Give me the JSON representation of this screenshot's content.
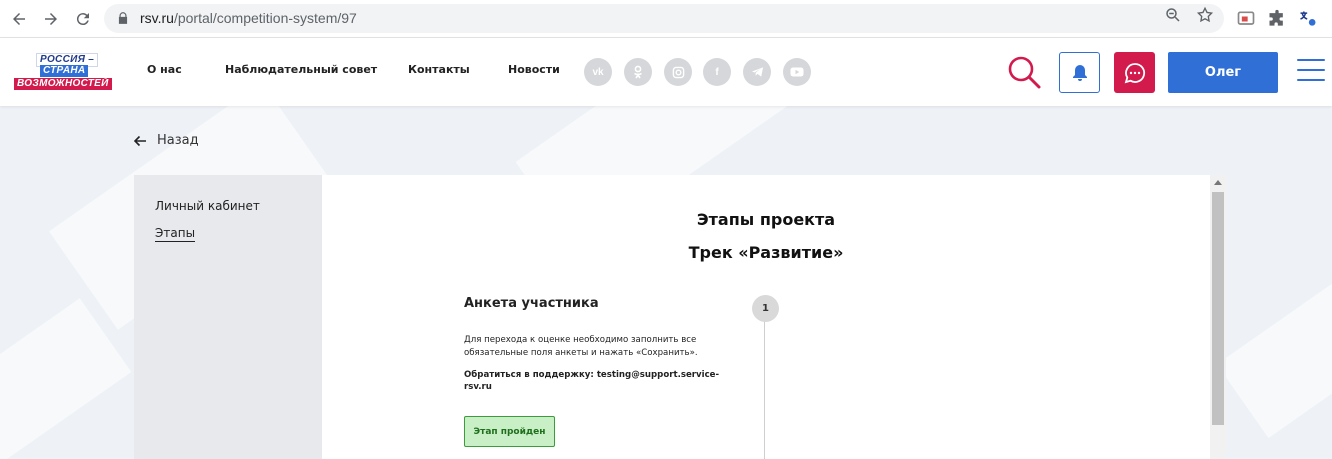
{
  "browser": {
    "url_host": "rsv.ru",
    "url_path": "/portal/competition-system/97"
  },
  "logo": {
    "line1": "РОССИЯ –",
    "line2": "СТРАНА",
    "line3": "ВОЗМОЖНОСТЕЙ"
  },
  "menu": {
    "items": [
      {
        "label": "О нас"
      },
      {
        "label": "Наблюдательный совет"
      },
      {
        "label": "Контакты"
      },
      {
        "label": "Новости"
      }
    ]
  },
  "social": {
    "items": [
      {
        "icon": "vk-icon",
        "glyph": "vk"
      },
      {
        "icon": "odnoklassniki-icon",
        "glyph": ""
      },
      {
        "icon": "instagram-icon",
        "glyph": ""
      },
      {
        "icon": "facebook-icon",
        "glyph": "f"
      },
      {
        "icon": "telegram-icon",
        "glyph": ""
      },
      {
        "icon": "youtube-icon",
        "glyph": ""
      }
    ]
  },
  "header": {
    "user_label": "Олег"
  },
  "colors": {
    "brand_blue": "#2f6fd6",
    "brand_red": "#d21a4c",
    "status_green": "#c9efc6"
  },
  "back": {
    "label": "Назад"
  },
  "sidebar": {
    "items": [
      {
        "label": "Личный кабинет"
      },
      {
        "label": "Этапы"
      }
    ]
  },
  "main": {
    "title": "Этапы проекта",
    "subtitle": "Трек «Развитие»",
    "step": {
      "number": "1",
      "title": "Анкета участника",
      "description": "Для перехода к оценке необходимо заполнить все обязательные поля анкеты и нажать «Сохранить».",
      "support": "Обратиться в поддержку: testing@support.service-rsv.ru",
      "status": "Этап пройден"
    }
  }
}
